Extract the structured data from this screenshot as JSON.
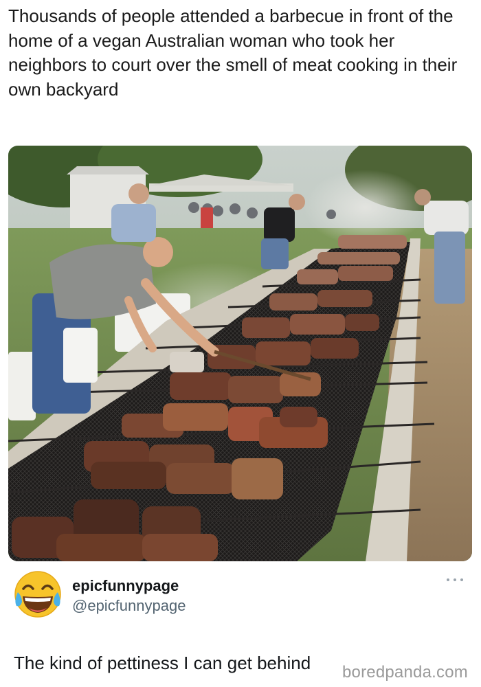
{
  "post": {
    "text": "Thousands of people attended a barbecue in front of the home of a vegan Australian woman who took her neighbors to court over the smell of meat cooking in their own backyard"
  },
  "photo": {
    "subject": "bbq-grill-photo"
  },
  "reply": {
    "avatar_icon": "laughing-crying-emoji-icon",
    "display_name": "epicfunnypage",
    "handle": "@epicfunnypage",
    "more_icon": "more-options-icon",
    "text": "The kind of pettiness I can get behind"
  },
  "watermark": {
    "text": "boredpanda.com"
  },
  "colors": {
    "handle": "#536471",
    "text": "#14171a",
    "watermark": "#9a9a9a"
  }
}
